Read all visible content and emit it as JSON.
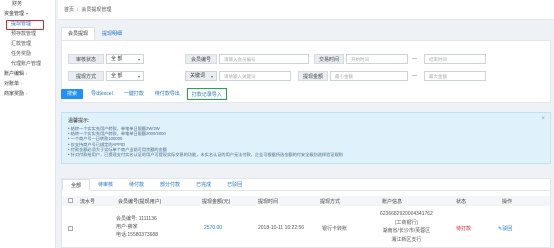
{
  "sidebar": {
    "top": "财务",
    "groups": [
      {
        "label": "资金管理",
        "items": [
          "提现管理",
          "预存款管理",
          "汇款管理",
          "任务奖励",
          "代理账户管理"
        ]
      },
      {
        "label": "账户编辑",
        "items": []
      },
      {
        "label": "对账单",
        "items": []
      },
      {
        "label": "商家奖励",
        "items": []
      }
    ]
  },
  "breadcrumb": [
    "首页",
    "会员提现管理"
  ],
  "tabs": [
    "会员提现",
    "提现明细"
  ],
  "filters": {
    "audit_status_label": "审核状态",
    "audit_status_value": "全 部",
    "member_no_label": "会员编号",
    "member_no_placeholder": "请输入会员编号",
    "time_label": "交易时间",
    "time_start_placeholder": "开始时间",
    "time_end_placeholder": "结束时间",
    "method_label": "提现方式",
    "method_value": "全 部",
    "keyword_select": "关键词",
    "keyword_placeholder": "请依输入关键词",
    "amount_label": "提现金额",
    "amount_min_placeholder": "最小金额",
    "amount_max_placeholder": "最大金额"
  },
  "actions": {
    "search": "搜索",
    "export_excel": "导出excel",
    "one_click_pay": "一键打款",
    "pending_export": "待付款导出",
    "import_records": "打款记录导入"
  },
  "notice": {
    "title": "温馨提示:",
    "lines": [
      "• 结转一个实实充用户转款，单笔单日限额2W/2W",
      "• 结转一个实实充用户转款，单笔单日限额2000/2000",
      "• 一个商户号一日转款100000",
      "• 仅支持商户号已绑定的APPID",
      "• 付款金额必须大于实际单个商户当前可用余额的金额",
      "• 针对付款给用户，已提现支付实名认证的用户可提现实际交易的功能，未实名认证的用户无法付款，企业可根据所选金额的付安全级别选择验证规则"
    ]
  },
  "status_tabs": [
    "全部",
    "待审核",
    "待付款",
    "部分付款",
    "已完成",
    "已驳回"
  ],
  "table": {
    "headers": [
      "流水号",
      "会员编号(提现用户)",
      "提现金额(元)",
      "提现时间",
      "提现方式",
      "账户信息",
      "状态",
      "操作"
    ],
    "rows": [
      {
        "member_no": "会员编号: 1111136",
        "member_name": "用户-薛家",
        "member_phone": "电话:15580373688",
        "amount": "2570.00",
        "time": "2018-10-11 16:22:56",
        "method": "银行卡转账",
        "account": [
          "6236682920004341762",
          "(工商银行)",
          "湖南省/长沙市/芙蓉区",
          "湘江新区支行"
        ],
        "status": "待打款",
        "operation": "驳回"
      }
    ]
  }
}
